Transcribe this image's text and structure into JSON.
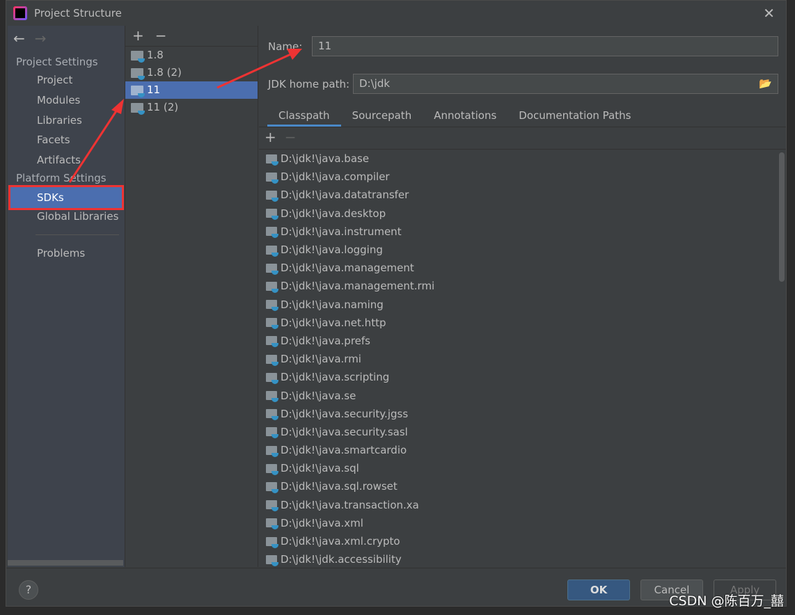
{
  "window": {
    "title": "Project Structure"
  },
  "sidebar": {
    "project_settings": "Project Settings",
    "items": [
      "Project",
      "Modules",
      "Libraries",
      "Facets",
      "Artifacts"
    ],
    "platform_settings": "Platform Settings",
    "platform_items": [
      "SDKs",
      "Global Libraries"
    ],
    "problems": "Problems",
    "selected": "SDKs"
  },
  "sdks": {
    "items": [
      "1.8",
      "1.8 (2)",
      "11",
      "11 (2)"
    ],
    "selected": "11"
  },
  "detail": {
    "name_label": "Name:",
    "name_value": "11",
    "home_label": "JDK home path:",
    "home_value": "D:\\jdk",
    "tabs": [
      "Classpath",
      "Sourcepath",
      "Annotations",
      "Documentation Paths"
    ],
    "active_tab": "Classpath",
    "classpath": [
      "D:\\jdk!\\java.base",
      "D:\\jdk!\\java.compiler",
      "D:\\jdk!\\java.datatransfer",
      "D:\\jdk!\\java.desktop",
      "D:\\jdk!\\java.instrument",
      "D:\\jdk!\\java.logging",
      "D:\\jdk!\\java.management",
      "D:\\jdk!\\java.management.rmi",
      "D:\\jdk!\\java.naming",
      "D:\\jdk!\\java.net.http",
      "D:\\jdk!\\java.prefs",
      "D:\\jdk!\\java.rmi",
      "D:\\jdk!\\java.scripting",
      "D:\\jdk!\\java.se",
      "D:\\jdk!\\java.security.jgss",
      "D:\\jdk!\\java.security.sasl",
      "D:\\jdk!\\java.smartcardio",
      "D:\\jdk!\\java.sql",
      "D:\\jdk!\\java.sql.rowset",
      "D:\\jdk!\\java.transaction.xa",
      "D:\\jdk!\\java.xml",
      "D:\\jdk!\\java.xml.crypto",
      "D:\\jdk!\\jdk.accessibility"
    ]
  },
  "buttons": {
    "ok": "OK",
    "cancel": "Cancel",
    "apply": "Apply",
    "help": "?"
  },
  "watermark": "CSDN @陈百万_囍",
  "colors": {
    "selection": "#4b6eaf",
    "annotation": "#e33333",
    "ok": "#365880"
  }
}
